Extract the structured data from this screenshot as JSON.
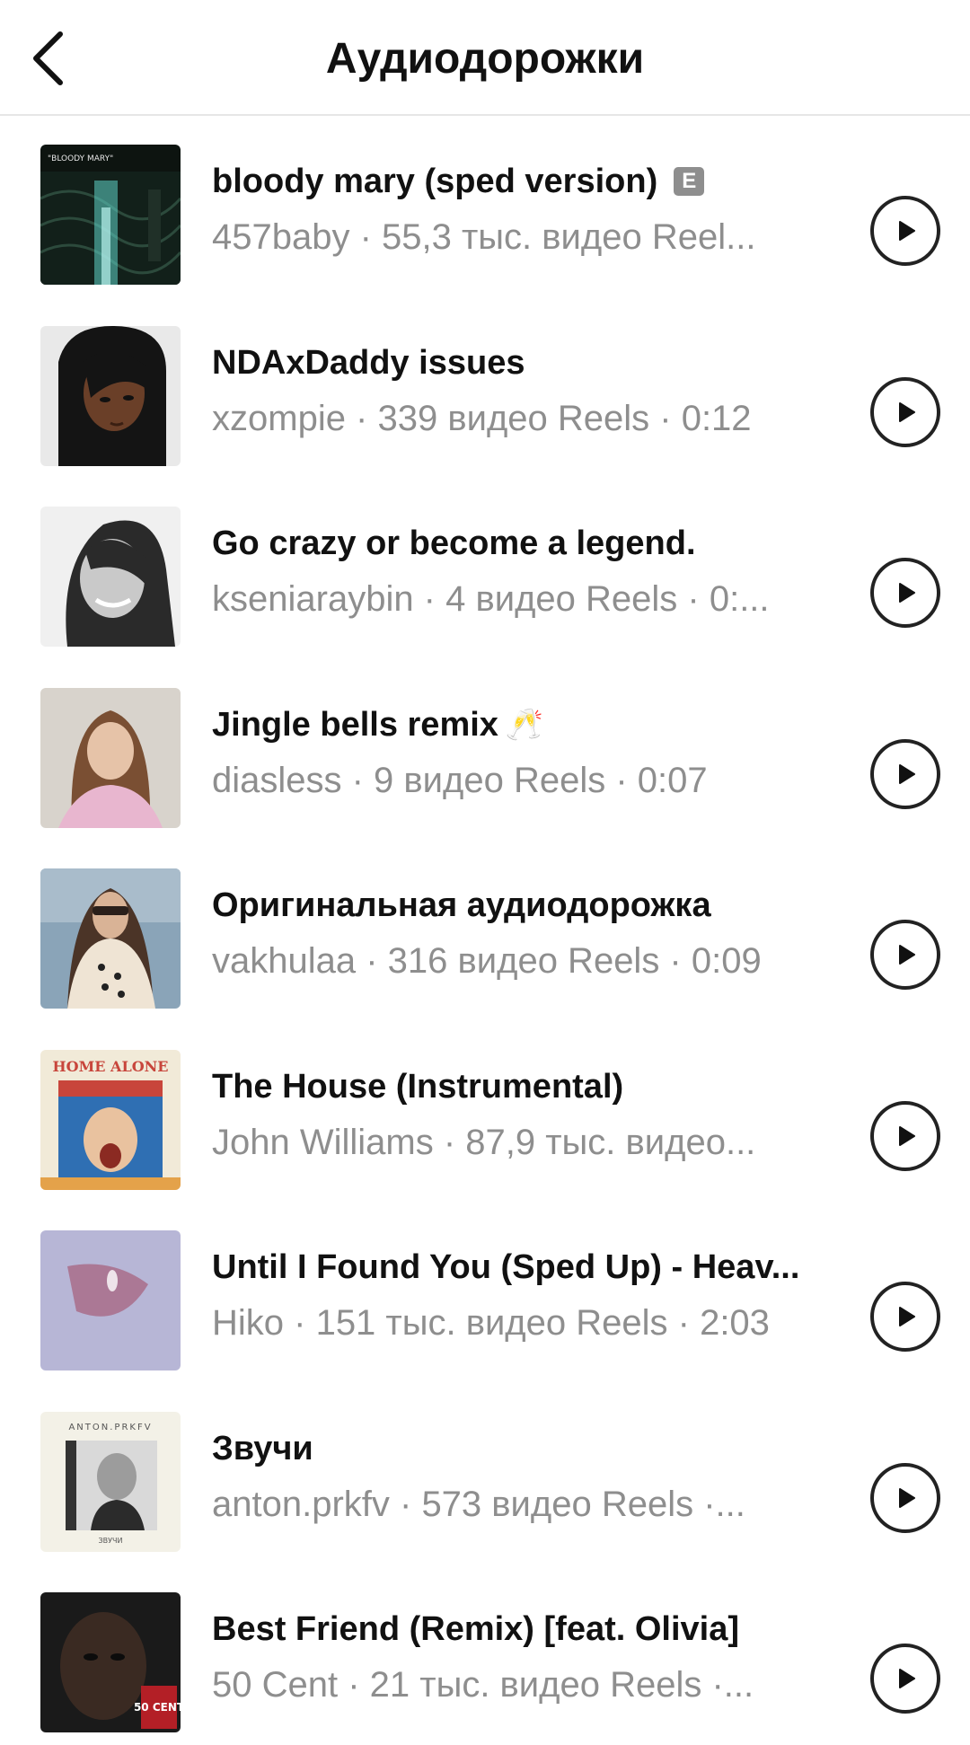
{
  "header": {
    "title": "Аудиодорожки",
    "back_icon": "chevron-left-icon"
  },
  "tracks": [
    {
      "title": "bloody mary (sped version)",
      "explicit_label": "E",
      "meta": "457baby · 55,3 тыс. видео Reel...",
      "cover_text": "\"BLOODY MARY\""
    },
    {
      "title": "NDAxDaddy issues",
      "meta": "xzompie · 339 видео Reels · 0:12"
    },
    {
      "title": "Go crazy or become a legend.",
      "meta": "kseniaraybin · 4 видео Reels · 0:..."
    },
    {
      "title": "Jingle bells remix",
      "emoji": "🥂",
      "meta": "diasless · 9 видео Reels · 0:07"
    },
    {
      "title": "Оригинальная аудиодорожка",
      "meta": "vakhulaa · 316 видео Reels · 0:09"
    },
    {
      "title": "The House (Instrumental)",
      "meta": "John Williams · 87,9 тыс. видео...",
      "cover_text": "HOME ALONE"
    },
    {
      "title": "Until I Found You (Sped Up) - Heav...",
      "meta": "Hiko · 151 тыс. видео Reels · 2:03"
    },
    {
      "title": "Звучи",
      "meta": "anton.prkfv · 573 видео Reels ·...",
      "cover_text": "ANTON.PRKFV",
      "cover_subtext": "ЗВУЧИ"
    },
    {
      "title": "Best Friend (Remix) [feat. Olivia]",
      "meta": "50 Cent · 21 тыс. видео Reels ·...",
      "cover_text": "50 CENT"
    }
  ],
  "icons": {
    "play": "play-icon"
  },
  "colors": {
    "text_primary": "#111111",
    "text_secondary": "#8e8e8e",
    "divider": "#e6e6e6",
    "explicit_badge": "#8e8e8e"
  }
}
